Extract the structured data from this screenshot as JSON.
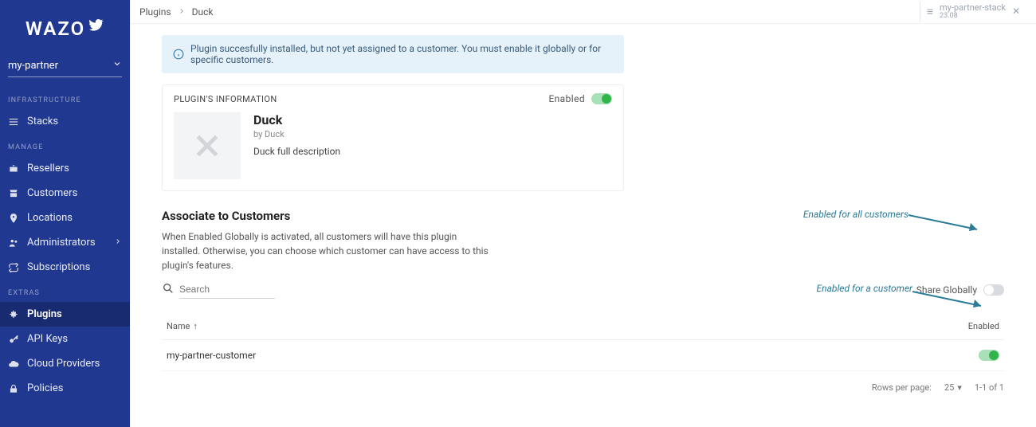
{
  "brand": "WAZO",
  "tenant": "my-partner",
  "sidebar": {
    "sections": [
      {
        "header": "INFRASTRUCTURE",
        "items": [
          {
            "label": "Stacks",
            "icon": "menu-icon"
          }
        ]
      },
      {
        "header": "MANAGE",
        "items": [
          {
            "label": "Resellers",
            "icon": "briefcase-icon"
          },
          {
            "label": "Customers",
            "icon": "store-icon"
          },
          {
            "label": "Locations",
            "icon": "pin-icon"
          },
          {
            "label": "Administrators",
            "icon": "people-icon",
            "chevron": true
          },
          {
            "label": "Subscriptions",
            "icon": "loop-icon"
          }
        ]
      },
      {
        "header": "EXTRAS",
        "items": [
          {
            "label": "Plugins",
            "icon": "puzzle-icon",
            "active": true
          },
          {
            "label": "API Keys",
            "icon": "key-icon"
          },
          {
            "label": "Cloud Providers",
            "icon": "cloud-icon"
          },
          {
            "label": "Policies",
            "icon": "lock-icon"
          }
        ]
      }
    ]
  },
  "breadcrumb": {
    "root": "Plugins",
    "current": "Duck"
  },
  "stack": {
    "name": "my-partner-stack",
    "version": "23.08"
  },
  "alert": "Plugin succesfully installed, but not yet assigned to a customer. You must enable it globally or for specific customers.",
  "card": {
    "header": "PLUGIN'S INFORMATION",
    "enabled_label": "Enabled",
    "title": "Duck",
    "by": "by Duck",
    "desc": "Duck full description"
  },
  "assoc": {
    "title": "Associate to Customers",
    "desc": "When Enabled Globally is activated, all customers will have this plugin installed. Otherwise, you can choose which customer can have access to this plugin's features.",
    "search_placeholder": "Search",
    "share_label": "Share Globally"
  },
  "table": {
    "name_header": "Name",
    "enabled_header": "Enabled",
    "rows": [
      {
        "name": "my-partner-customer",
        "enabled": true
      }
    ]
  },
  "pager": {
    "rows_label": "Rows per page:",
    "rows_value": "25",
    "range": "1-1 of 1"
  },
  "annotations": {
    "all": "Enabled for all customers",
    "one": "Enabled for a customer"
  },
  "colors": {
    "sidebar": "#203890",
    "alert_bg": "#e6f2fa",
    "accent_green": "#2fb54a",
    "annotation": "#2a7a98"
  }
}
